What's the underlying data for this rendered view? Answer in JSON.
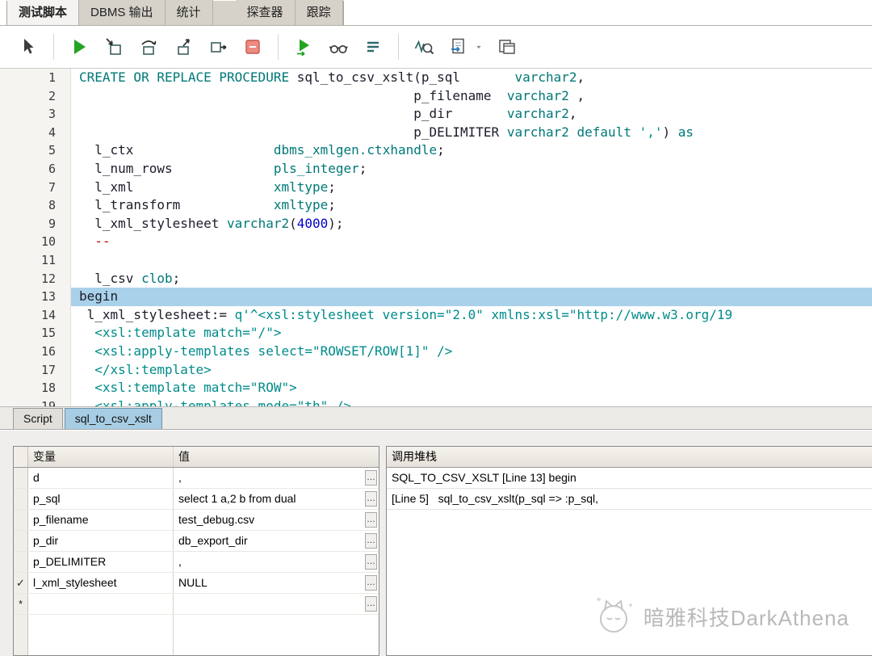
{
  "colors": {
    "kw": "#007878",
    "str": "#008b8b",
    "num": "#0000c8",
    "comment": "#c40000",
    "ident": "#1c1c2a",
    "hl_line": "#a9d1ea",
    "tab_active": "#a7cde4",
    "gutter_bg": "#f6f4f1",
    "run_green": "#23a523",
    "break_red": "#ee8a80"
  },
  "top_tabs": [
    {
      "id": "test-script",
      "label": "测试脚本",
      "active": true
    },
    {
      "id": "dbms-output",
      "label": "DBMS 输出",
      "active": false
    },
    {
      "id": "statistics",
      "label": "统计",
      "active": false
    },
    {
      "spacer": true
    },
    {
      "id": "profiler",
      "label": "探查器",
      "active": false
    },
    {
      "id": "trace",
      "label": "跟踪",
      "active": false
    }
  ],
  "toolbar": {
    "items": [
      {
        "icon": "select-pointer-button"
      },
      {
        "sep": true
      },
      {
        "icon": "run-button"
      },
      {
        "icon": "step-into-button"
      },
      {
        "icon": "step-over-button"
      },
      {
        "icon": "step-out-button"
      },
      {
        "icon": "run-to-exception-button"
      },
      {
        "icon": "breakpoint-button"
      },
      {
        "sep": true
      },
      {
        "icon": "start-debugger-button"
      },
      {
        "icon": "watches-button"
      },
      {
        "icon": "dbms-output-button"
      },
      {
        "sep": true
      },
      {
        "icon": "profiler-button"
      },
      {
        "icon": "export-results-button"
      },
      {
        "icon": "dropdown-caret",
        "caret": true
      },
      {
        "icon": "window-list-button"
      }
    ]
  },
  "editor": {
    "highlight_line": 13,
    "lines": [
      {
        "n": "1",
        "s": [
          [
            "k",
            "CREATE OR REPLACE PROCEDURE "
          ],
          [
            "i",
            "sql_to_csv_xslt(p_sql       "
          ],
          [
            "k",
            "varchar2"
          ],
          [
            "i",
            ","
          ]
        ]
      },
      {
        "n": "2",
        "s": [
          [
            "i",
            "                                           p_filename  "
          ],
          [
            "k",
            "varchar2"
          ],
          [
            "i",
            " ,"
          ]
        ]
      },
      {
        "n": "3",
        "s": [
          [
            "i",
            "                                           p_dir       "
          ],
          [
            "k",
            "varchar2"
          ],
          [
            "i",
            ","
          ]
        ]
      },
      {
        "n": "4",
        "s": [
          [
            "i",
            "                                           p_DELIMITER "
          ],
          [
            "k",
            "varchar2"
          ],
          [
            "i",
            " "
          ],
          [
            "k",
            "default"
          ],
          [
            "i",
            " "
          ],
          [
            "s",
            "','"
          ],
          [
            "i",
            ") "
          ],
          [
            "k",
            "as"
          ]
        ]
      },
      {
        "n": "5",
        "s": [
          [
            "i",
            "  l_ctx                  "
          ],
          [
            "k",
            "dbms_xmlgen.ctxhandle"
          ],
          [
            "i",
            ";"
          ]
        ]
      },
      {
        "n": "6",
        "s": [
          [
            "i",
            "  l_num_rows             "
          ],
          [
            "k",
            "pls_integer"
          ],
          [
            "i",
            ";"
          ]
        ]
      },
      {
        "n": "7",
        "s": [
          [
            "i",
            "  l_xml                  "
          ],
          [
            "k",
            "xmltype"
          ],
          [
            "i",
            ";"
          ]
        ]
      },
      {
        "n": "8",
        "s": [
          [
            "i",
            "  l_transform            "
          ],
          [
            "k",
            "xmltype"
          ],
          [
            "i",
            ";"
          ]
        ]
      },
      {
        "n": "9",
        "s": [
          [
            "i",
            "  l_xml_stylesheet "
          ],
          [
            "k",
            "varchar2"
          ],
          [
            "i",
            "("
          ],
          [
            "n",
            "4000"
          ],
          [
            "i",
            ");"
          ]
        ]
      },
      {
        "n": "10",
        "s": [
          [
            "c",
            "  --"
          ]
        ]
      },
      {
        "n": "11",
        "s": []
      },
      {
        "n": "12",
        "s": [
          [
            "i",
            "  l_csv "
          ],
          [
            "k",
            "clob"
          ],
          [
            "i",
            ";"
          ]
        ]
      },
      {
        "n": "13",
        "h": true,
        "s": [
          [
            "i",
            "begin"
          ]
        ]
      },
      {
        "n": "14",
        "s": [
          [
            "i",
            " l_xml_stylesheet:= "
          ],
          [
            "s",
            "q'^<xsl:stylesheet version=\"2.0\" xmlns:xsl=\"http://www.w3.org/19"
          ]
        ]
      },
      {
        "n": "15",
        "s": [
          [
            "s",
            "  <xsl:template match=\"/\">"
          ]
        ]
      },
      {
        "n": "16",
        "s": [
          [
            "s",
            "  <xsl:apply-templates select=\"ROWSET/ROW[1]\" />"
          ]
        ]
      },
      {
        "n": "17",
        "s": [
          [
            "s",
            "  </xsl:template>"
          ]
        ]
      },
      {
        "n": "18",
        "s": [
          [
            "s",
            "  <xsl:template match=\"ROW\">"
          ]
        ]
      },
      {
        "n": "19",
        "s": [
          [
            "s",
            "  <xsl:apply-templates mode=\"th\" />"
          ]
        ]
      }
    ]
  },
  "bottom_tabs": [
    {
      "id": "script",
      "label": "Script",
      "active": false
    },
    {
      "id": "sql-to-csv-xslt",
      "label": "sql_to_csv_xslt",
      "active": true
    }
  ],
  "variables_panel": {
    "columns": [
      "变量",
      "值"
    ],
    "rows": [
      {
        "indicator": "",
        "name": "d",
        "value": ","
      },
      {
        "indicator": "",
        "name": "p_sql",
        "value": "select 1 a,2 b from dual"
      },
      {
        "indicator": "",
        "name": "p_filename",
        "value": "test_debug.csv"
      },
      {
        "indicator": "",
        "name": "p_dir",
        "value": "db_export_dir"
      },
      {
        "indicator": "",
        "name": "p_DELIMITER",
        "value": ","
      },
      {
        "indicator": "✓",
        "name": "l_xml_stylesheet",
        "value": "NULL"
      },
      {
        "indicator": "*",
        "name": "",
        "value": ""
      }
    ]
  },
  "callstack_panel": {
    "title": "调用堆栈",
    "entries": [
      "SQL_TO_CSV_XSLT [Line 13] begin",
      "[Line 5]   sql_to_csv_xslt(p_sql => :p_sql,"
    ]
  },
  "watermark": {
    "text": "暗雅科技DarkAthena"
  }
}
